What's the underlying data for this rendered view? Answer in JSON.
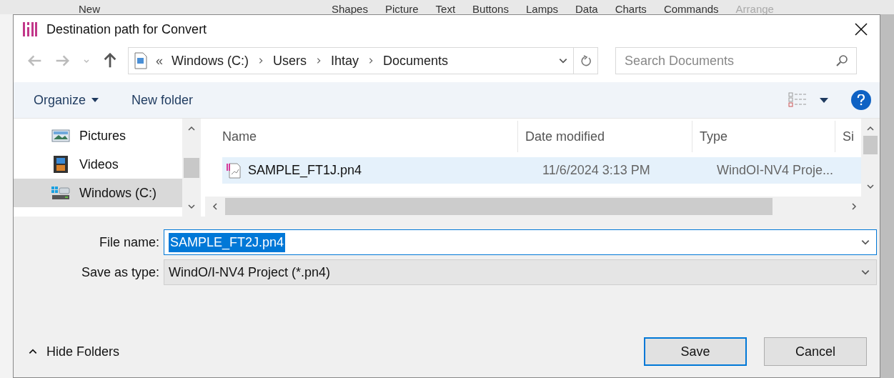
{
  "background_app": {
    "menu": [
      {
        "label": "New",
        "disabled": false
      },
      {
        "label": "Shapes",
        "disabled": false
      },
      {
        "label": "Picture",
        "disabled": false
      },
      {
        "label": "Text",
        "disabled": false
      },
      {
        "label": "Buttons",
        "disabled": false
      },
      {
        "label": "Lamps",
        "disabled": false
      },
      {
        "label": "Data",
        "disabled": false
      },
      {
        "label": "Charts",
        "disabled": false
      },
      {
        "label": "Commands",
        "disabled": false
      },
      {
        "label": "Arrange",
        "disabled": true
      }
    ]
  },
  "window": {
    "title": "Destination path for Convert"
  },
  "address": {
    "prefix": "«",
    "path": [
      "Windows (C:)",
      "Users",
      "Ihtay",
      "Documents"
    ]
  },
  "search": {
    "placeholder": "Search Documents"
  },
  "toolbar": {
    "organize": "Organize",
    "new_folder": "New folder"
  },
  "nav": [
    {
      "label": "Pictures",
      "kind": "pictures",
      "selected": false
    },
    {
      "label": "Videos",
      "kind": "videos",
      "selected": false
    },
    {
      "label": "Windows (C:)",
      "kind": "drive",
      "selected": true
    }
  ],
  "columns": [
    "Name",
    "Date modified",
    "Type",
    "Si"
  ],
  "files": [
    {
      "name": "SAMPLE_FT1J.pn4",
      "date": "11/6/2024 3:13 PM",
      "type": "WindOI-NV4 Proje...",
      "selected": true
    }
  ],
  "file_name": {
    "label": "File name:",
    "value": "SAMPLE_FT2J.pn4"
  },
  "save_type": {
    "label": "Save as type:",
    "value": "WindO/I-NV4 Project (*.pn4)"
  },
  "hide_folders": "Hide Folders",
  "buttons": [
    {
      "label": "Save",
      "kind": "primary"
    },
    {
      "label": "Cancel",
      "kind": "secondary"
    }
  ]
}
